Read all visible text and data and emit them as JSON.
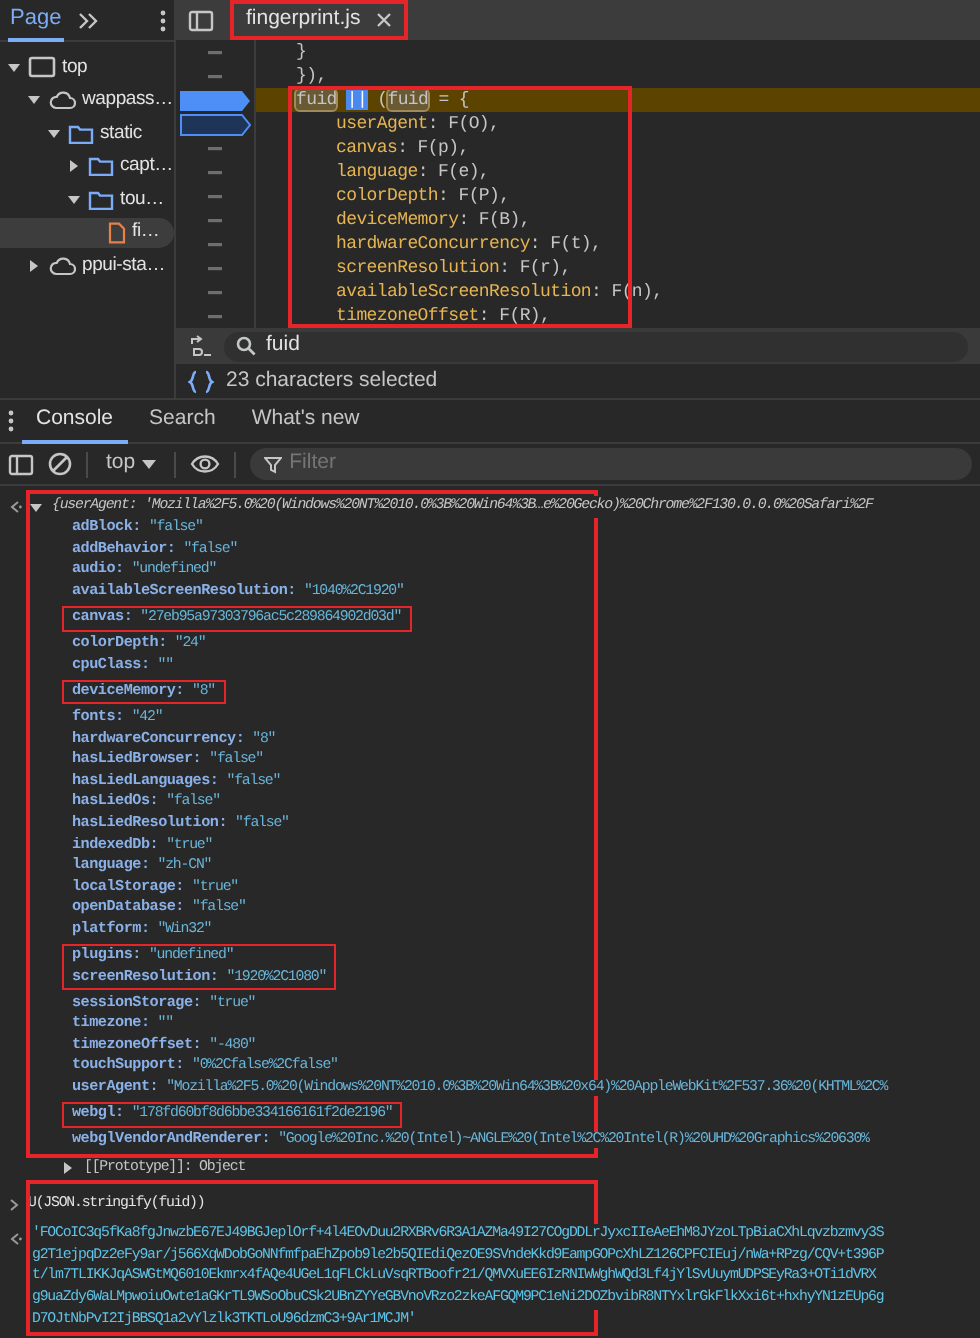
{
  "sources": {
    "tabs": [
      {
        "label": "Page",
        "selected": true
      }
    ],
    "tree": [
      {
        "label": "top",
        "kind": "frame",
        "expanded": true,
        "selected": false,
        "children": [
          {
            "label": "wappass…",
            "kind": "cloud",
            "expanded": true,
            "selected": false,
            "children": [
              {
                "label": "static",
                "kind": "folder",
                "expanded": true,
                "selected": false,
                "children": [
                  {
                    "label": "capt…",
                    "kind": "folder",
                    "expanded": false,
                    "selected": false
                  },
                  {
                    "label": "tou…",
                    "kind": "folder",
                    "expanded": true,
                    "selected": false,
                    "children": [
                      {
                        "label": "fi…",
                        "kind": "file",
                        "selected": true
                      }
                    ]
                  }
                ]
              }
            ]
          },
          {
            "label": "ppui-sta…",
            "kind": "cloud",
            "expanded": false,
            "selected": false
          }
        ]
      }
    ],
    "file_tab": {
      "label": "fingerprint.js",
      "boxed": true
    },
    "code_boxed": true,
    "code_lines": [
      {
        "kind": "statement",
        "current": false,
        "breakpoint": false,
        "disabled": false,
        "parts": [
          {
            "kind": "plain",
            "text": "}"
          }
        ]
      },
      {
        "kind": "statement",
        "current": false,
        "breakpoint": false,
        "disabled": false,
        "parts": [
          {
            "kind": "plain",
            "text": "}),"
          }
        ]
      },
      {
        "kind": "statement",
        "current": true,
        "breakpoint": true,
        "disabled": false,
        "parts": [
          {
            "kind": "match",
            "text": "fuid"
          },
          {
            "kind": "selection",
            "text": "||"
          },
          {
            "kind": "plain",
            "text": "("
          },
          {
            "kind": "match",
            "text": "fuid"
          },
          {
            "kind": "plain",
            "text": " = {"
          }
        ]
      },
      {
        "kind": "member",
        "current": false,
        "breakpoint": true,
        "disabled": true,
        "parts": [
          {
            "kind": "key",
            "text": "userAgent"
          },
          {
            "kind": "plain",
            "text": ": F(O),"
          }
        ]
      },
      {
        "kind": "member",
        "current": false,
        "breakpoint": false,
        "disabled": false,
        "parts": [
          {
            "kind": "key",
            "text": "canvas"
          },
          {
            "kind": "plain",
            "text": ": F(p),"
          }
        ]
      },
      {
        "kind": "member",
        "current": false,
        "breakpoint": false,
        "disabled": false,
        "parts": [
          {
            "kind": "key",
            "text": "language"
          },
          {
            "kind": "plain",
            "text": ": F(e),"
          }
        ]
      },
      {
        "kind": "member",
        "current": false,
        "breakpoint": false,
        "disabled": false,
        "parts": [
          {
            "kind": "key",
            "text": "colorDepth"
          },
          {
            "kind": "plain",
            "text": ": F(P),"
          }
        ]
      },
      {
        "kind": "member",
        "current": false,
        "breakpoint": false,
        "disabled": false,
        "parts": [
          {
            "kind": "key",
            "text": "deviceMemory"
          },
          {
            "kind": "plain",
            "text": ": F(B),"
          }
        ]
      },
      {
        "kind": "member",
        "current": false,
        "breakpoint": false,
        "disabled": false,
        "parts": [
          {
            "kind": "key",
            "text": "hardwareConcurrency"
          },
          {
            "kind": "plain",
            "text": ": F(t),"
          }
        ]
      },
      {
        "kind": "member",
        "current": false,
        "breakpoint": false,
        "disabled": false,
        "parts": [
          {
            "kind": "key",
            "text": "screenResolution"
          },
          {
            "kind": "plain",
            "text": ": F(r),"
          }
        ]
      },
      {
        "kind": "member",
        "current": false,
        "breakpoint": false,
        "disabled": false,
        "parts": [
          {
            "kind": "key",
            "text": "availableScreenResolution"
          },
          {
            "kind": "plain",
            "text": ": F(n),"
          }
        ]
      },
      {
        "kind": "member",
        "current": false,
        "breakpoint": false,
        "disabled": false,
        "parts": [
          {
            "kind": "key",
            "text": "timezoneOffset"
          },
          {
            "kind": "plain",
            "text": ": F(R),"
          }
        ]
      }
    ],
    "search": {
      "value": "fuid"
    },
    "status": "23 characters selected"
  },
  "drawer": {
    "tabs": [
      {
        "label": "Console",
        "selected": true
      },
      {
        "label": "Search",
        "selected": false
      },
      {
        "label": "What's new",
        "selected": false
      }
    ],
    "context": "top",
    "filter": {
      "placeholder": "Filter"
    }
  },
  "console": [
    {
      "kind": "object",
      "boxed": true,
      "expanded": true,
      "preview": "{userAgent: 'Mozilla%2F5.0%20(Windows%20NT%2010.0%3B%20Win64%3B…e%20Gecko)%20Chrome%2F130.0.0.0%20Safari%2F",
      "properties": [
        {
          "key": "adBlock:",
          "value": "\"false\"",
          "boxed": false
        },
        {
          "key": "addBehavior:",
          "value": "\"false\"",
          "boxed": false
        },
        {
          "key": "audio:",
          "value": "\"undefined\"",
          "boxed": false
        },
        {
          "key": "availableScreenResolution:",
          "value": "\"1040%2C1920\"",
          "boxed": false
        },
        {
          "key": "canvas:",
          "value": "\"27eb95a97303796ac5c289864902d03d\"",
          "boxed": true
        },
        {
          "key": "colorDepth:",
          "value": "\"24\"",
          "boxed": false
        },
        {
          "key": "cpuClass:",
          "value": "\"\"",
          "boxed": false
        },
        {
          "key": "deviceMemory:",
          "value": "\"8\"",
          "boxed": true
        },
        {
          "key": "fonts:",
          "value": "\"42\"",
          "boxed": false
        },
        {
          "key": "hardwareConcurrency:",
          "value": "\"8\"",
          "boxed": false
        },
        {
          "key": "hasLiedBrowser:",
          "value": "\"false\"",
          "boxed": false
        },
        {
          "key": "hasLiedLanguages:",
          "value": "\"false\"",
          "boxed": false
        },
        {
          "key": "hasLiedOs:",
          "value": "\"false\"",
          "boxed": false
        },
        {
          "key": "hasLiedResolution:",
          "value": "\"false\"",
          "boxed": false
        },
        {
          "key": "indexedDb:",
          "value": "\"true\"",
          "boxed": false
        },
        {
          "key": "language:",
          "value": "\"zh-CN\"",
          "boxed": false
        },
        {
          "key": "localStorage:",
          "value": "\"true\"",
          "boxed": false
        },
        {
          "key": "openDatabase:",
          "value": "\"false\"",
          "boxed": false
        },
        {
          "key": "platform:",
          "value": "\"Win32\"",
          "boxed": false
        },
        {
          "key": "plugins:",
          "value": "\"undefined\"",
          "boxed": true
        },
        {
          "key": "screenResolution:",
          "value": "\"1920%2C1080\"",
          "boxed": true
        },
        {
          "key": "sessionStorage:",
          "value": "\"true\"",
          "boxed": false
        },
        {
          "key": "timezone:",
          "value": "\"\"",
          "boxed": false
        },
        {
          "key": "timezoneOffset:",
          "value": "\"-480\"",
          "boxed": false
        },
        {
          "key": "touchSupport:",
          "value": "\"0%2Cfalse%2Cfalse\"",
          "boxed": false
        },
        {
          "key": "userAgent:",
          "value": "\"Mozilla%2F5.0%20(Windows%20NT%2010.0%3B%20Win64%3B%20x64)%20AppleWebKit%2F537.36%20(KHTML%2C%",
          "boxed": false
        },
        {
          "key": "webgl:",
          "value": "\"178fd60bf8d6bbe334166161f2de2196\"",
          "boxed": true
        },
        {
          "key": "webglVendorAndRenderer:",
          "value": "\"Google%20Inc.%20(Intel)~ANGLE%20(Intel%2C%20Intel(R)%20UHD%20Graphics%20630%",
          "boxed": false
        }
      ],
      "prototype": {
        "label": "[[Prototype]]: Object",
        "expanded": false
      }
    },
    {
      "kind": "input",
      "boxed": true,
      "text": "U(JSON.stringify(fuid))"
    },
    {
      "kind": "string",
      "boxed": true,
      "lines": [
        "'FOCoIC3q5fKa8fgJnwzbE67EJ49BGJeplOrf+4l4EOvDuu2RXBRv6R3A1AZMa49I27COgDDLrJyxcIIeAeEhM8JYzoLTpBiaCXhLqvzbzmvy3S",
        "g2T1ejpqDz2eFy9ar/j566XqWDobGoNNfmfpaEhZpob9le2b5QIEdiQezOE9SVndeKkd9EampGOPcXhLZ126CPFCIEuj/nWa+RPzg/CQV+t396P",
        "t/lm7TLIKKJqASWGtMQ6010Ekmrx4fAQe4UGeL1qFLCkLuVsqRTBoofr21/QMVXuEE6IzRNIWWghWQd3Lf4jYlSvUuymUDPSEyRa3+OTi1dVRX",
        "g9uaZdy6WaLMpwoiuOwte1aGKrTL9WSoObuCSk2UBnZYYeGBVnoVRzo2zkeAFGQM9PC1eNi2DOZbvibR8NTYxlrGkFlkXxi6t+hxhyYN1zEUp6g",
        "D7OJtNbPvI2IjBBSQ1a2vYlzlk3TKTLoU96dzmC3+9Ar1MCJM'"
      ]
    }
  ]
}
